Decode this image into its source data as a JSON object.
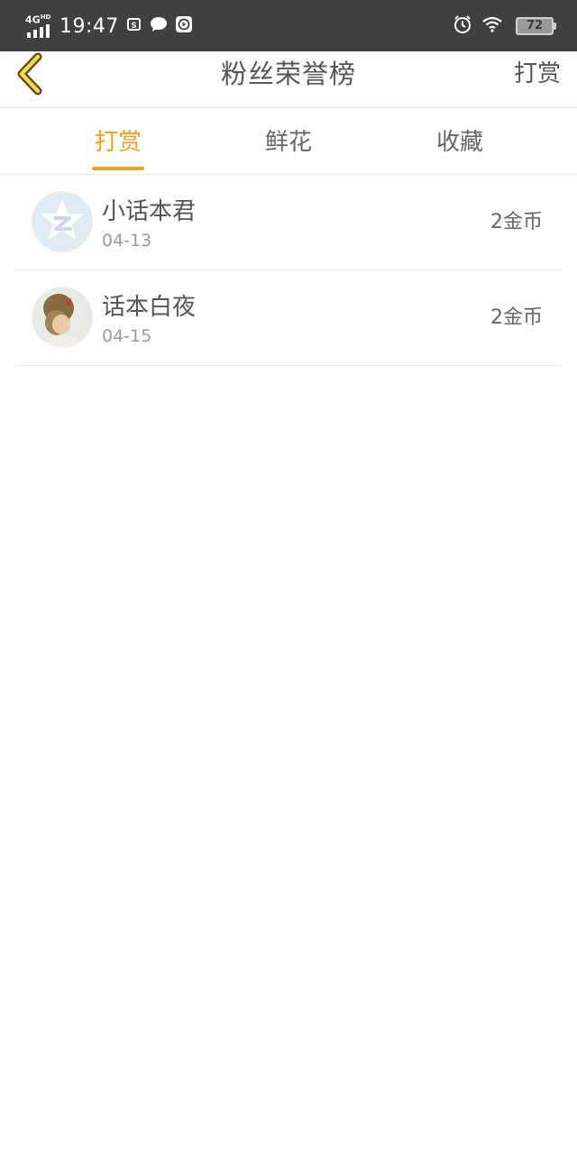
{
  "status_bar": {
    "network": "4G",
    "network_sub": "HD",
    "time": "19:47",
    "battery": "72",
    "icons": [
      "signal-icon",
      "screenshot-icon",
      "chat-bubble-icon",
      "play-icon",
      "alarm-icon",
      "wifi-icon",
      "battery-icon"
    ]
  },
  "header": {
    "title": "粉丝荣誉榜",
    "action_label": "打赏",
    "back_icon": "chevron-left-icon",
    "accent_color": "#f0a023"
  },
  "tabs": [
    {
      "label": "打赏",
      "active": true
    },
    {
      "label": "鲜花",
      "active": false
    },
    {
      "label": "收藏",
      "active": false
    }
  ],
  "entries": [
    {
      "name": "小话本君",
      "date": "04-13",
      "amount": "2金币",
      "avatar": "default-star-avatar"
    },
    {
      "name": "话本白夜",
      "date": "04-15",
      "amount": "2金币",
      "avatar": "photo-avatar"
    }
  ]
}
